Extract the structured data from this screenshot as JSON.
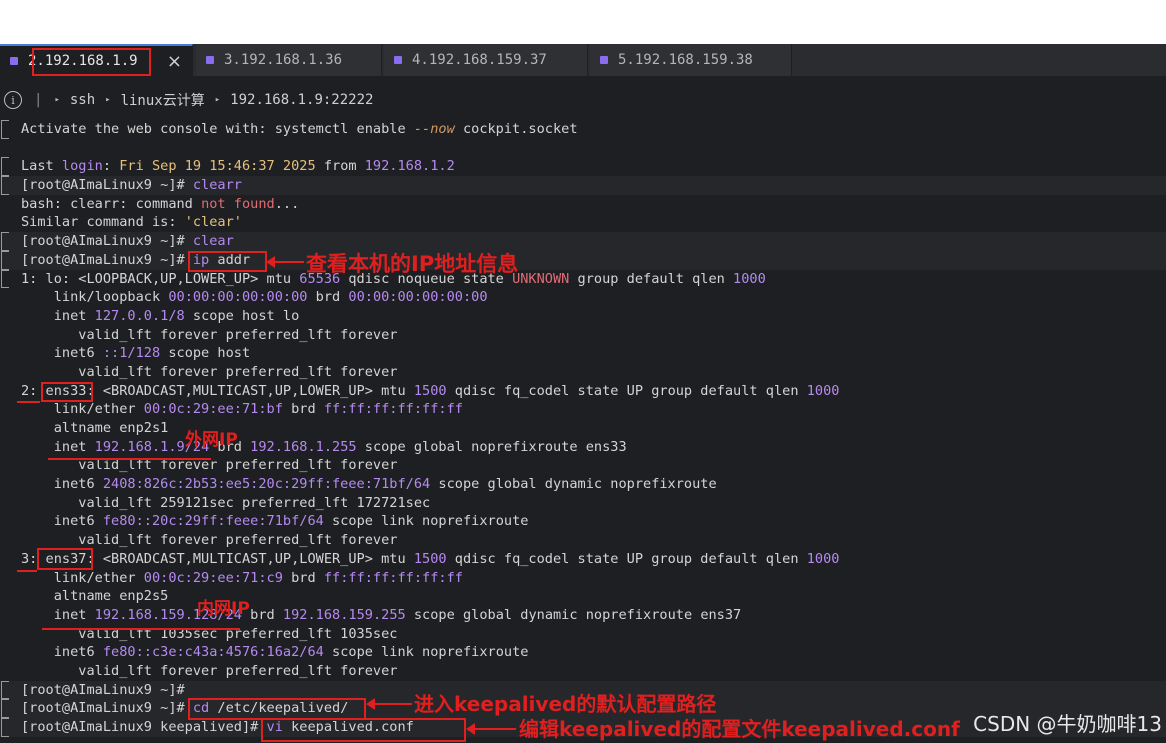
{
  "tabs": [
    {
      "label": "2.192.168.1.9",
      "color": "#8b6cf0",
      "active": true
    },
    {
      "label": "3.192.168.1.36",
      "color": "#8b6cf0",
      "active": false
    },
    {
      "label": "4.192.168.159.37",
      "color": "#8b6cf0",
      "active": false
    },
    {
      "label": "5.192.168.159.38",
      "color": "#8b6cf0",
      "active": false
    }
  ],
  "tab_close_icon": "×",
  "breadcrumb": {
    "items": [
      "ssh",
      "linux云计算",
      "192.168.1.9:22222"
    ],
    "separator_glyph": "▸"
  },
  "terminal": {
    "lines": [
      "Activate the web console with: systemctl enable --now cockpit.socket",
      "",
      "Last login: Fri Sep 19 15:46:37 2025 from 192.168.1.2",
      "[root@AImaLinux9 ~]# clearr",
      "bash: clearr: command not found...",
      "Similar command is: 'clear'",
      "[root@AImaLinux9 ~]# clear",
      "[root@AImaLinux9 ~]# ip addr",
      "1: lo: <LOOPBACK,UP,LOWER_UP> mtu 65536 qdisc noqueue state UNKNOWN group default qlen 1000",
      "    link/loopback 00:00:00:00:00:00 brd 00:00:00:00:00:00",
      "    inet 127.0.0.1/8 scope host lo",
      "       valid_lft forever preferred_lft forever",
      "    inet6 ::1/128 scope host",
      "       valid_lft forever preferred_lft forever",
      "2: ens33: <BROADCAST,MULTICAST,UP,LOWER_UP> mtu 1500 qdisc fq_codel state UP group default qlen 1000",
      "    link/ether 00:0c:29:ee:71:bf brd ff:ff:ff:ff:ff:ff",
      "    altname enp2s1",
      "    inet 192.168.1.9/24 brd 192.168.1.255 scope global noprefixroute ens33",
      "       valid_lft forever preferred_lft forever",
      "    inet6 2408:826c:2b53:ee5:20c:29ff:feee:71bf/64 scope global dynamic noprefixroute",
      "       valid_lft 259121sec preferred_lft 172721sec",
      "    inet6 fe80::20c:29ff:feee:71bf/64 scope link noprefixroute",
      "       valid_lft forever preferred_lft forever",
      "3: ens37: <BROADCAST,MULTICAST,UP,LOWER_UP> mtu 1500 qdisc fq_codel state UP group default qlen 1000",
      "    link/ether 00:0c:29:ee:71:c9 brd ff:ff:ff:ff:ff:ff",
      "    altname enp2s5",
      "    inet 192.168.159.128/24 brd 192.168.159.255 scope global dynamic noprefixroute ens37",
      "       valid_lft 1035sec preferred_lft 1035sec",
      "    inet6 fe80::c3e:c43a:4576:16a2/64 scope link noprefixroute",
      "       valid_lft forever preferred_lft forever",
      "[root@AImaLinux9 ~]#",
      "[root@AImaLinux9 ~]# cd /etc/keepalived/",
      "[root@AImaLinux9 keepalived]# vi keepalived.conf"
    ]
  },
  "annotations": {
    "ip_addr_note": "查看本机的IP地址信息",
    "external_ip_note": "外网IP",
    "internal_ip_note": "内网IP",
    "cd_note": "进入keepalived的默认配置路径",
    "vi_note": "编辑keepalived的配置文件keepalived.conf",
    "annotation_color": "#e01f1f"
  },
  "watermark": "CSDN @牛奶咖啡13"
}
